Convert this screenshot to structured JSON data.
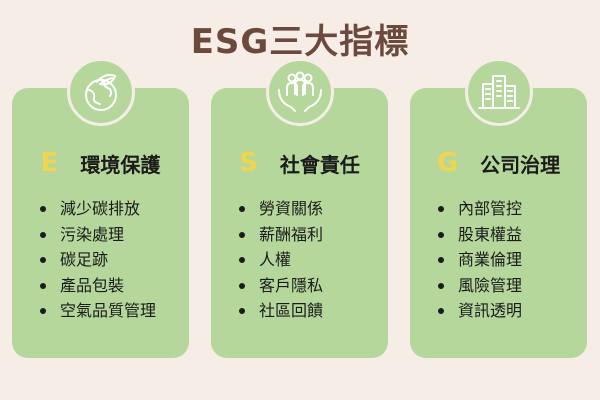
{
  "title": "ESG三大指標",
  "colors": {
    "background": "#f5ede6",
    "card": "#b5d79c",
    "letter": "#f2d54e",
    "title": "#6b4a3d"
  },
  "pillars": [
    {
      "letter": "E",
      "label": "環境保護",
      "icon": "globe-leaf-icon",
      "items": [
        "減少碳排放",
        "污染處理",
        "碳足跡",
        "產品包裝",
        "空氣品質管理"
      ]
    },
    {
      "letter": "S",
      "label": "社會責任",
      "icon": "people-hands-icon",
      "items": [
        "勞資關係",
        "薪酬福利",
        "人權",
        "客戶隱私",
        "社區回饋"
      ]
    },
    {
      "letter": "G",
      "label": "公司治理",
      "icon": "buildings-icon",
      "items": [
        "內部管控",
        "股東權益",
        "商業倫理",
        "風險管理",
        "資訊透明"
      ]
    }
  ]
}
